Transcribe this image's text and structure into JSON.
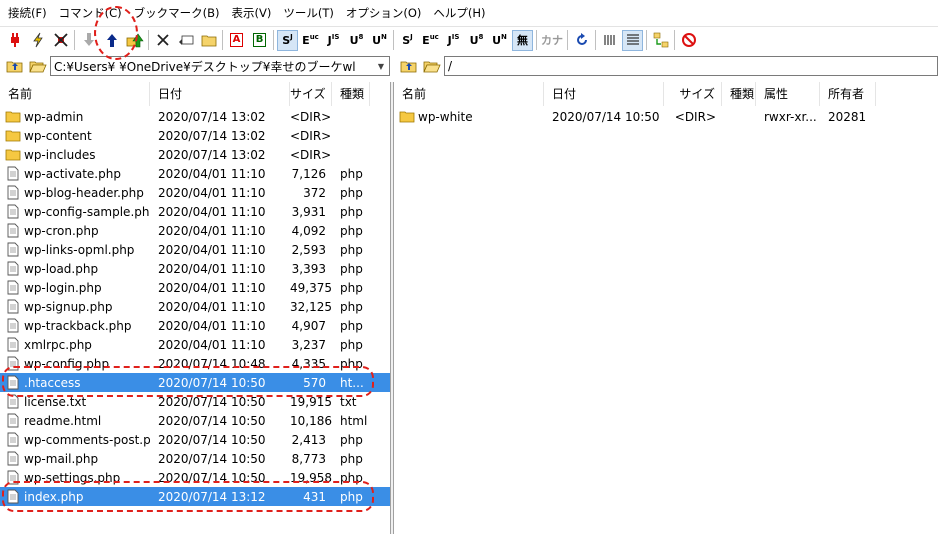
{
  "menu": [
    "接続(F)",
    "コマンド(C)",
    "ブックマーク(B)",
    "表示(V)",
    "ツール(T)",
    "オプション(O)",
    "ヘルプ(H)"
  ],
  "toolbar": {
    "connect_icon": "plug-icon",
    "quick_connect_icon": "lightning-icon",
    "disconnect_icon": "disconnect-icon",
    "download_icon": "download-arrow-icon",
    "upload_icon": "upload-arrow-icon",
    "mirror_upload_icon": "mirror-upload-icon",
    "delete_icon": "delete-x-icon",
    "rename_icon": "rename-icon",
    "mkdir_icon": "new-folder-icon",
    "transfer_ascii": "A",
    "transfer_binary": "B",
    "kanji_labels": [
      "S",
      "E",
      "J",
      "U",
      "U"
    ],
    "kanji_labels2": [
      "S",
      "E",
      "J",
      "U",
      "U"
    ],
    "no_convert": "無",
    "kana": "カナ",
    "refresh_icon": "refresh-icon",
    "list_view_icon": "list-view-icon",
    "detail_view_icon": "detail-view-icon",
    "sync_icon": "sync-dir-icon",
    "stop_icon": "stop-icon"
  },
  "left_path": "C:¥Users¥ ¥OneDrive¥デスクトップ¥幸せのブーケwl",
  "right_path": "/",
  "left_headers": {
    "name": "名前",
    "date": "日付",
    "size": "サイズ",
    "type": "種類"
  },
  "right_headers": {
    "name": "名前",
    "date": "日付",
    "size": "サイズ",
    "type": "種類",
    "attr": "属性",
    "owner": "所有者"
  },
  "left_files": [
    {
      "name": "wp-admin",
      "date": "2020/07/14 13:02",
      "size": "<DIR>",
      "type": "",
      "icon": "folder",
      "selected": false
    },
    {
      "name": "wp-content",
      "date": "2020/07/14 13:02",
      "size": "<DIR>",
      "type": "",
      "icon": "folder",
      "selected": false
    },
    {
      "name": "wp-includes",
      "date": "2020/07/14 13:02",
      "size": "<DIR>",
      "type": "",
      "icon": "folder",
      "selected": false
    },
    {
      "name": "wp-activate.php",
      "date": "2020/04/01 11:10",
      "size": "7,126",
      "type": "php",
      "icon": "file",
      "selected": false
    },
    {
      "name": "wp-blog-header.php",
      "date": "2020/04/01 11:10",
      "size": "372",
      "type": "php",
      "icon": "file",
      "selected": false
    },
    {
      "name": "wp-config-sample.php",
      "date": "2020/04/01 11:10",
      "size": "3,931",
      "type": "php",
      "icon": "file",
      "selected": false
    },
    {
      "name": "wp-cron.php",
      "date": "2020/04/01 11:10",
      "size": "4,092",
      "type": "php",
      "icon": "file",
      "selected": false
    },
    {
      "name": "wp-links-opml.php",
      "date": "2020/04/01 11:10",
      "size": "2,593",
      "type": "php",
      "icon": "file",
      "selected": false
    },
    {
      "name": "wp-load.php",
      "date": "2020/04/01 11:10",
      "size": "3,393",
      "type": "php",
      "icon": "file",
      "selected": false
    },
    {
      "name": "wp-login.php",
      "date": "2020/04/01 11:10",
      "size": "49,375",
      "type": "php",
      "icon": "file",
      "selected": false
    },
    {
      "name": "wp-signup.php",
      "date": "2020/04/01 11:10",
      "size": "32,125",
      "type": "php",
      "icon": "file",
      "selected": false
    },
    {
      "name": "wp-trackback.php",
      "date": "2020/04/01 11:10",
      "size": "4,907",
      "type": "php",
      "icon": "file",
      "selected": false
    },
    {
      "name": "xmlrpc.php",
      "date": "2020/04/01 11:10",
      "size": "3,237",
      "type": "php",
      "icon": "file",
      "selected": false
    },
    {
      "name": "wp-config.php",
      "date": "2020/07/14 10:48",
      "size": "4,335",
      "type": "php",
      "icon": "file",
      "selected": false
    },
    {
      "name": ".htaccess",
      "date": "2020/07/14 10:50",
      "size": "570",
      "type": "ht...",
      "icon": "file",
      "selected": true
    },
    {
      "name": "license.txt",
      "date": "2020/07/14 10:50",
      "size": "19,915",
      "type": "txt",
      "icon": "file",
      "selected": false
    },
    {
      "name": "readme.html",
      "date": "2020/07/14 10:50",
      "size": "10,186",
      "type": "html",
      "icon": "file",
      "selected": false
    },
    {
      "name": "wp-comments-post.p...",
      "date": "2020/07/14 10:50",
      "size": "2,413",
      "type": "php",
      "icon": "file",
      "selected": false
    },
    {
      "name": "wp-mail.php",
      "date": "2020/07/14 10:50",
      "size": "8,773",
      "type": "php",
      "icon": "file",
      "selected": false
    },
    {
      "name": "wp-settings.php",
      "date": "2020/07/14 10:50",
      "size": "19,958",
      "type": "php",
      "icon": "file",
      "selected": false
    },
    {
      "name": "index.php",
      "date": "2020/07/14 13:12",
      "size": "431",
      "type": "php",
      "icon": "file",
      "selected": true
    }
  ],
  "right_files": [
    {
      "name": "wp-white",
      "date": "2020/07/14 10:50",
      "size": "<DIR>",
      "type": "",
      "attr": "rwxr-xr...",
      "owner": "20281",
      "icon": "folder"
    }
  ],
  "colors": {
    "selection": "#3a8ee6",
    "annotation": "#e0201b",
    "folder": "#f5c842"
  }
}
